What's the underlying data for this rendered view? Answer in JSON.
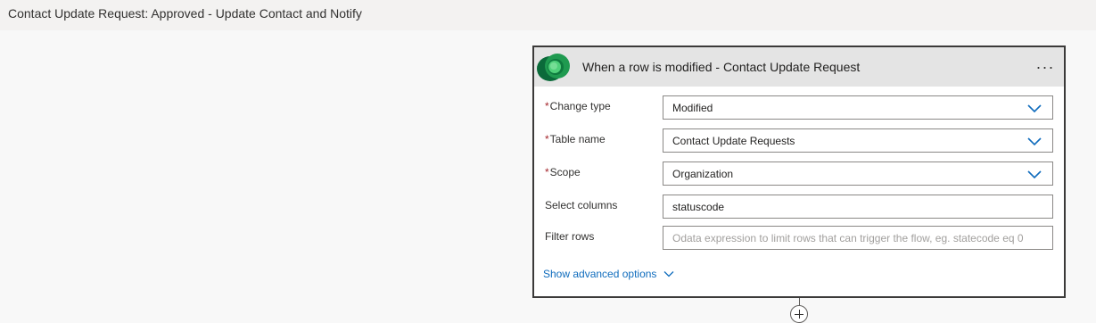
{
  "flow": {
    "title": "Contact Update Request: Approved - Update Contact and Notify"
  },
  "trigger": {
    "icon": "dataverse-logo-icon",
    "title": "When a row is modified - Contact Update Request",
    "more_label": "···",
    "fields": {
      "change_type": {
        "label": "Change type",
        "required": "*",
        "value": "Modified"
      },
      "table_name": {
        "label": "Table name",
        "required": "*",
        "value": "Contact Update Requests"
      },
      "scope": {
        "label": "Scope",
        "required": "*",
        "value": "Organization"
      },
      "select_columns": {
        "label": "Select columns",
        "value": "statuscode"
      },
      "filter_rows": {
        "label": "Filter rows",
        "value": "",
        "placeholder": "Odata expression to limit rows that can trigger the flow, eg. statecode eq 0"
      }
    },
    "advanced_label": "Show advanced options"
  },
  "colors": {
    "accent": "#0f6cbd",
    "required": "#a4262c",
    "card_border": "#3b3a39",
    "header_bg": "#e4e4e4",
    "logo_dark": "#0b6a3a",
    "logo_light": "#3dbf6a"
  }
}
